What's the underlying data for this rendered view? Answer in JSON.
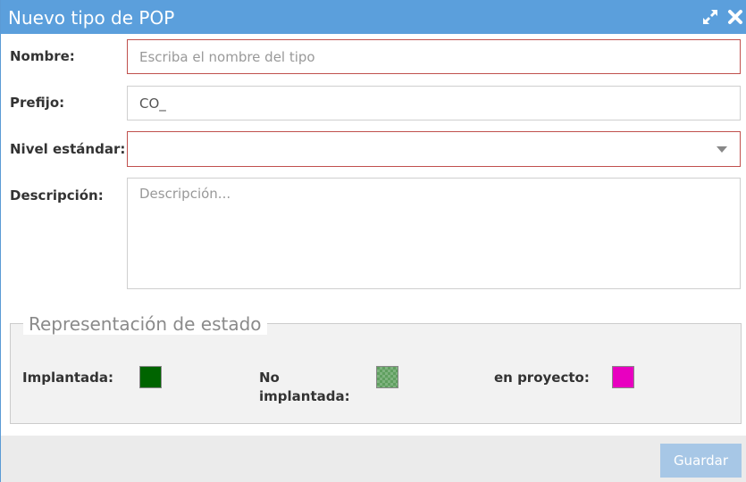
{
  "dialog": {
    "title": "Nuevo tipo de POP",
    "expand_icon": "expand-icon",
    "close_icon": "close-icon"
  },
  "form": {
    "nombre": {
      "label": "Nombre:",
      "placeholder": "Escriba el nombre del tipo",
      "value": ""
    },
    "prefijo": {
      "label": "Prefijo:",
      "value": "CO_"
    },
    "nivel": {
      "label": "Nivel estándar:",
      "value": ""
    },
    "descripcion": {
      "label": "Descripción:",
      "placeholder": "Descripción..."
    }
  },
  "estado": {
    "legend": "Representación de estado",
    "implantada": {
      "label": "Implantada:",
      "color": "#006400"
    },
    "no_implantada": {
      "label_line1": "No",
      "label_line2": "implantada:",
      "color": "#5f9f5f"
    },
    "en_proyecto": {
      "label": "en proyecto:",
      "color": "#e800c0"
    }
  },
  "footer": {
    "save_label": "Guardar"
  },
  "colors": {
    "titlebar": "#5b9fdc",
    "invalid_border": "#c0504d",
    "save_button": "#a7c7e6"
  }
}
